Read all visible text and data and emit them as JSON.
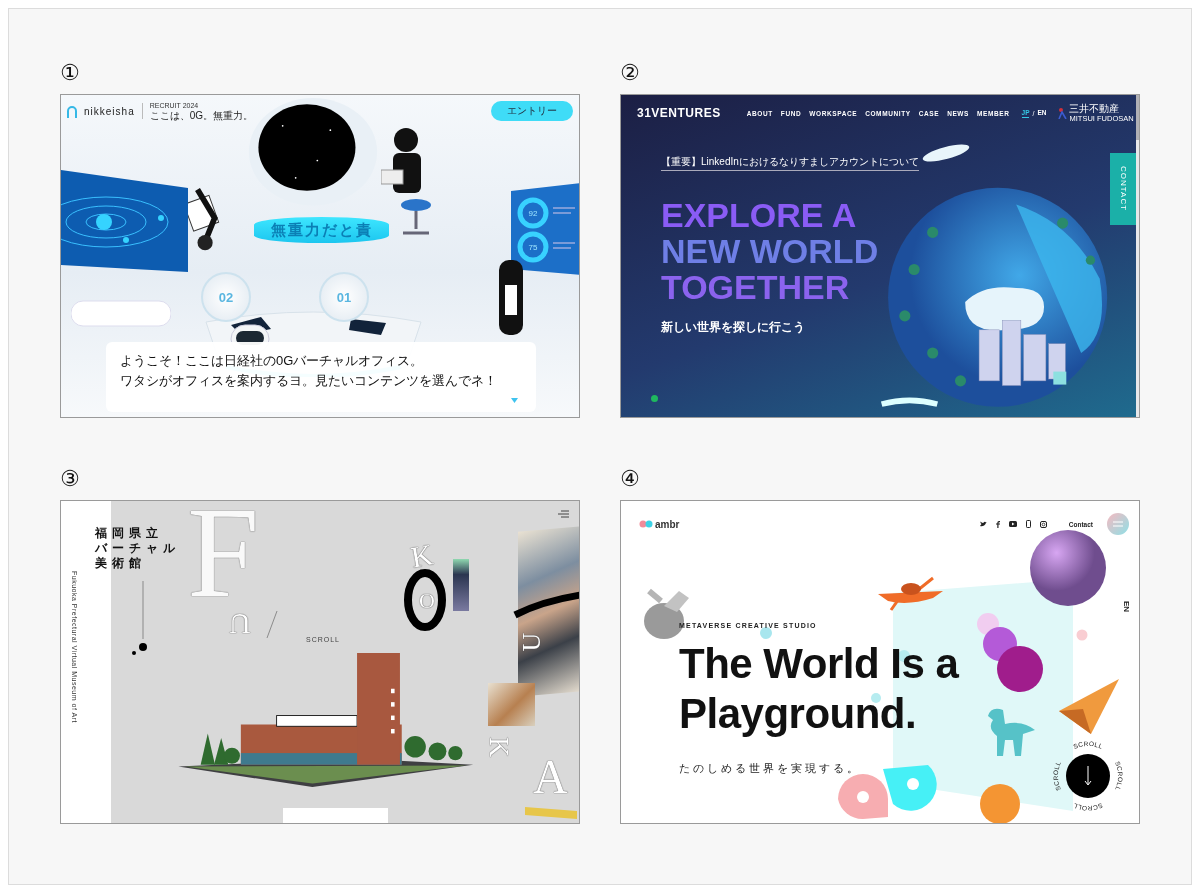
{
  "panels": [
    {
      "kind": "nikkei",
      "number": "①",
      "logo": "nikkeisha",
      "recruit": "RECRUIT 2024",
      "tagline": "ここは、0G。無重力。",
      "entry_button": "エントリー",
      "sign": "無重力だと責",
      "pods": [
        "02",
        "01"
      ],
      "gauges": [
        "92",
        "75"
      ],
      "dialog": [
        "ようこそ！ここは日経社の0Gバーチャルオフィス。",
        "ワタシがオフィスを案内するヨ。見たいコンテンツを選んでネ！"
      ]
    },
    {
      "kind": "ventures",
      "number": "②",
      "logo": "31VENTURES",
      "nav": [
        "ABOUT",
        "FUND",
        "WORKSPACE",
        "COMMUNITY",
        "CASE",
        "NEWS",
        "MEMBER"
      ],
      "languages": [
        {
          "label": "JP",
          "selected": true
        },
        {
          "label": "EN",
          "selected": false
        }
      ],
      "language_separator": "/",
      "partner_name": "三井不動産",
      "partner_roman": "MITSUI FUDOSAN",
      "notice_link": "【重要】LinkedInにおけるなりすましアカウントについて",
      "headline": [
        "EXPLORE A",
        "NEW WORLD",
        "TOGETHER"
      ],
      "subtitle": "新しい世界を探しに行こう",
      "contact_tab": "CONTACT"
    },
    {
      "kind": "museum",
      "number": "③",
      "title": [
        "福岡県立",
        "バーチャル",
        "美術館"
      ],
      "subtitle_vertical": "Fukuoka Prefectural Virtual Museum of Art",
      "letters": [
        "F",
        "K",
        "U",
        "O",
        "K",
        "A",
        "U"
      ],
      "scroll_label": "SCROLL"
    },
    {
      "kind": "ambr",
      "number": "④",
      "logo": "ambr",
      "contact_link": "Contact",
      "language": "EN",
      "eyebrow": "METAVERSE CREATIVE STUDIO",
      "headline": [
        "The World Is a",
        "Playground."
      ],
      "subtitle": "たのしめる世界を実現する。",
      "scroll_ring": [
        "SCROLL",
        "SCROLL",
        "SCROLL",
        "SCROLL"
      ]
    }
  ]
}
